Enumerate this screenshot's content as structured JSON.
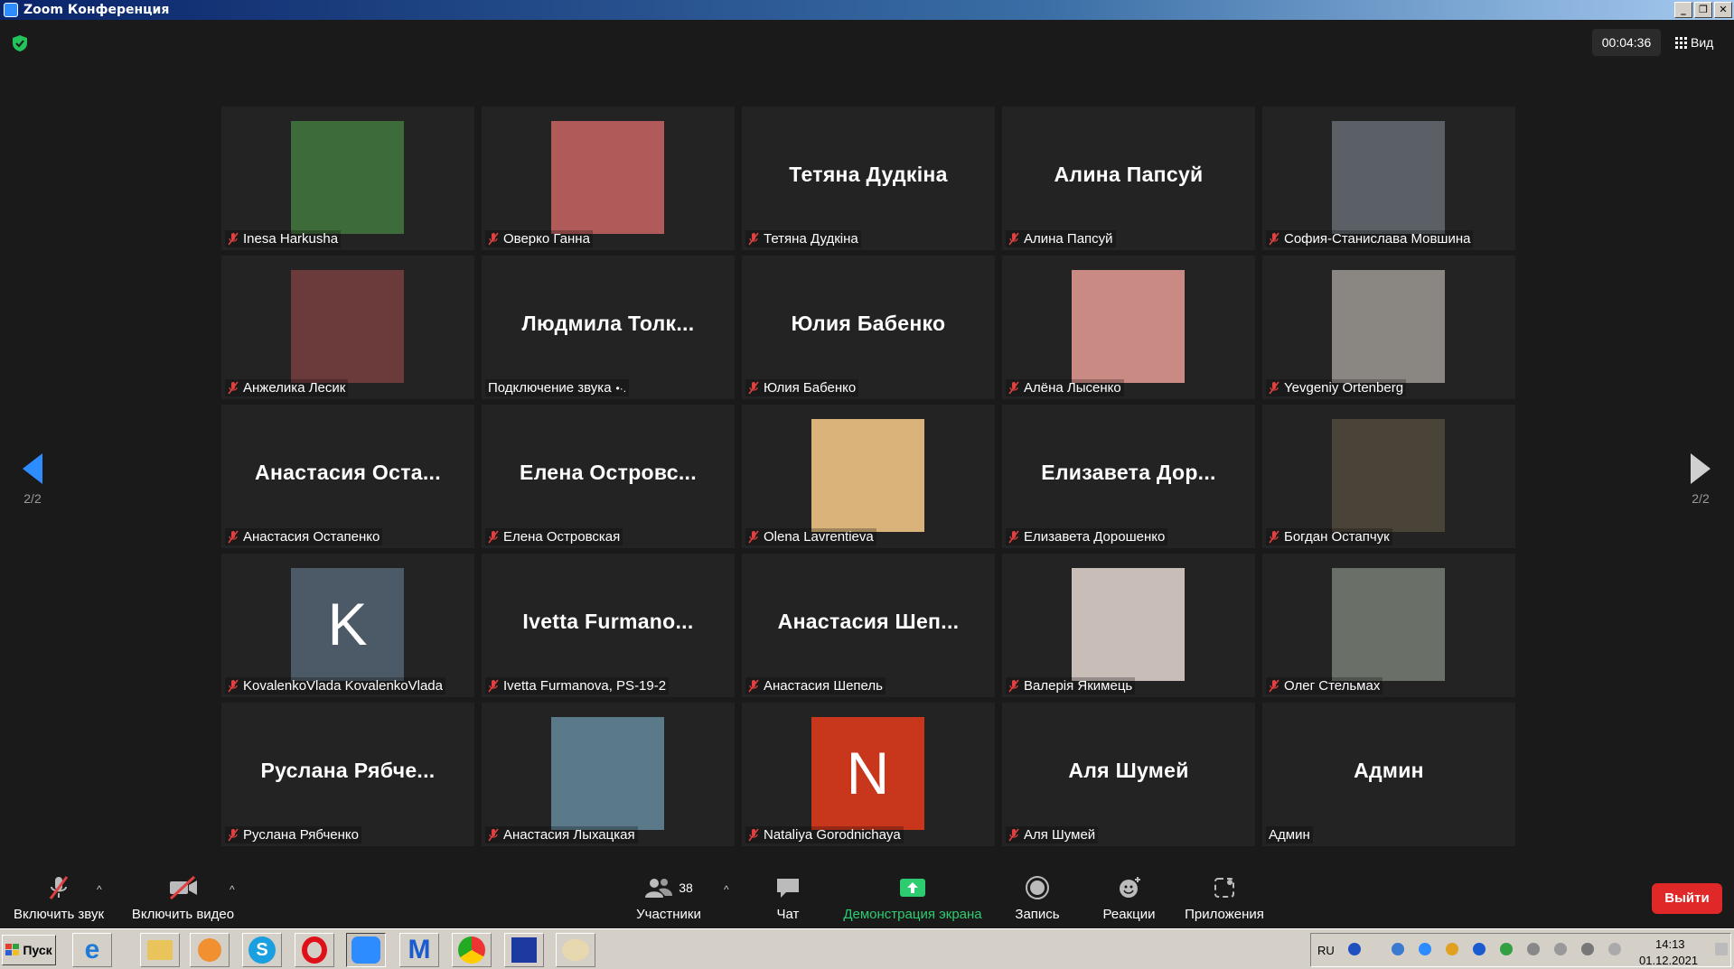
{
  "window": {
    "title": "Zoom Конференция",
    "buttons": [
      "_",
      "❐",
      "✕"
    ]
  },
  "meeting": {
    "timer": "00:04:36",
    "view_label": "Вид",
    "page_indicator": "2/2"
  },
  "tiles": [
    {
      "name": "Inesa Harkusha",
      "big": "",
      "photo": "#3d6b3a",
      "muted": true
    },
    {
      "name": "Оверко Ганна",
      "big": "",
      "photo": "#b05a5a",
      "muted": true
    },
    {
      "name": "Тетяна Дудкіна",
      "big": "Тетяна Дудкіна",
      "photo": "",
      "muted": true
    },
    {
      "name": "Алина Папсуй",
      "big": "Алина Папсуй",
      "photo": "",
      "muted": true
    },
    {
      "name": "София-Станислава Мовшина",
      "big": "",
      "photo": "#5a6066",
      "muted": true
    },
    {
      "name": "Анжелика Лесик",
      "big": "",
      "photo": "#6b3a3a",
      "muted": true
    },
    {
      "name": "Подключение звука",
      "big": "Людмила Толк...",
      "photo": "",
      "muted": false
    },
    {
      "name": "Юлия Бабенко",
      "big": "Юлия Бабенко",
      "photo": "",
      "muted": true
    },
    {
      "name": "Алёна Лысенко",
      "big": "",
      "photo": "#c98a84",
      "muted": true
    },
    {
      "name": "Yevgeniy Ortenberg",
      "big": "",
      "photo": "#8a8682",
      "muted": true
    },
    {
      "name": "Анастасия Остапенко",
      "big": "Анастасия Оста...",
      "photo": "",
      "muted": true
    },
    {
      "name": "Елена Островская",
      "big": "Елена Островс...",
      "photo": "",
      "muted": true
    },
    {
      "name": "Olena Lavrentieva",
      "big": "",
      "photo": "#d9b37a",
      "muted": true
    },
    {
      "name": "Елизавета Дорошенко",
      "big": "Елизавета Дор...",
      "photo": "",
      "muted": true
    },
    {
      "name": "Богдан Остапчук",
      "big": "",
      "photo": "#4a4438",
      "muted": true
    },
    {
      "name": "KovalenkoVlada KovalenkoVlada",
      "big": "",
      "photo": "#4b5a66",
      "letter": "K",
      "muted": true
    },
    {
      "name": "Ivetta Furmanova, PS-19-2",
      "big": "Ivetta Furmano...",
      "photo": "",
      "muted": true
    },
    {
      "name": "Анастасия Шепель",
      "big": "Анастасия Шеп...",
      "photo": "",
      "muted": true
    },
    {
      "name": "Валерія Якимець",
      "big": "",
      "photo": "#c9bdb8",
      "muted": true
    },
    {
      "name": "Олег Стельмах",
      "big": "",
      "photo": "#6a7068",
      "muted": true
    },
    {
      "name": "Руслана Рябченко",
      "big": "Руслана Рябче...",
      "photo": "",
      "muted": true
    },
    {
      "name": "Анастасия Лыхацкая",
      "big": "",
      "photo": "#5a7a8a",
      "muted": true
    },
    {
      "name": "Nataliya Gorodnichaya",
      "big": "",
      "photo": "#c8361c",
      "letter": "N",
      "muted": true
    },
    {
      "name": "Аля Шумей",
      "big": "Аля Шумей",
      "photo": "",
      "muted": true
    },
    {
      "name": "Админ",
      "big": "Админ",
      "photo": "",
      "muted": false
    }
  ],
  "toolbar": {
    "audio_label": "Включить звук",
    "video_label": "Включить видео",
    "participants_label": "Участники",
    "participants_count": "38",
    "chat_label": "Чат",
    "share_label": "Демонстрация экрана",
    "record_label": "Запись",
    "reactions_label": "Реакции",
    "apps_label": "Приложения",
    "leave_label": "Выйти"
  },
  "taskbar": {
    "start_label": "Пуск",
    "lang": "RU",
    "time": "14:13",
    "date": "01.12.2021"
  },
  "colors": {
    "accent": "#2d8cff",
    "share": "#2ecc71",
    "leave": "#e02828",
    "muted_icon": "#e04040"
  }
}
